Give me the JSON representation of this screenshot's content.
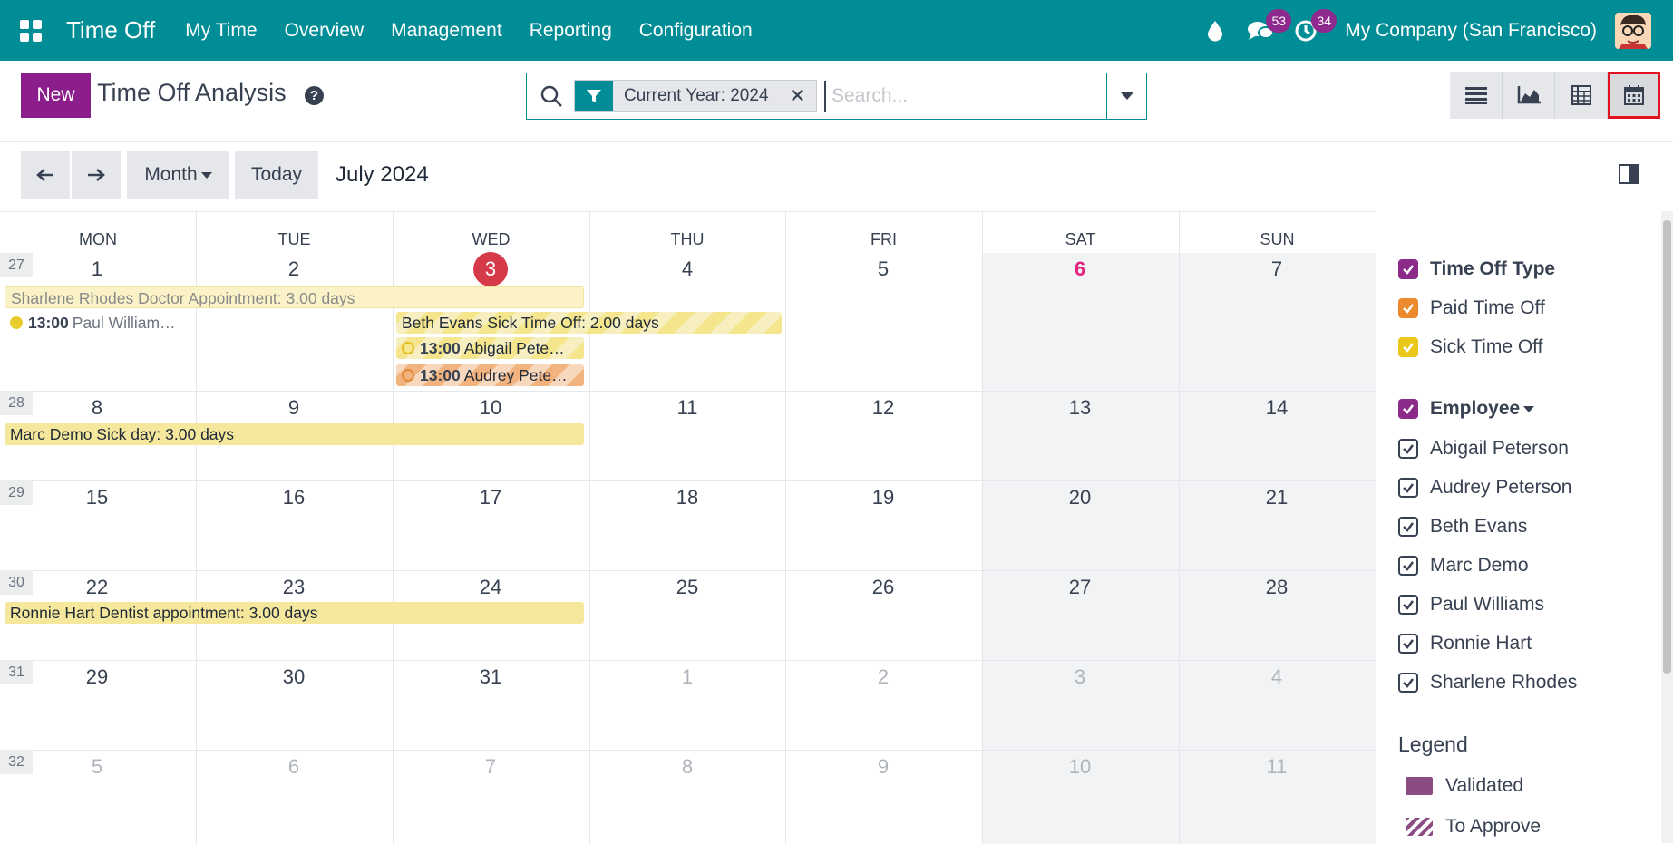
{
  "navbar": {
    "app_name": "Time Off",
    "menu": [
      "My Time",
      "Overview",
      "Management",
      "Reporting",
      "Configuration"
    ],
    "messages_count": "53",
    "activities_count": "34",
    "company": "My Company (San Francisco)"
  },
  "control": {
    "new_label": "New",
    "title": "Time Off Analysis",
    "facet_label": "Current Year: 2024",
    "search_placeholder": "Search..."
  },
  "toolbar": {
    "scale_label": "Month",
    "today_label": "Today",
    "period": "July 2024"
  },
  "calendar": {
    "weekdays": [
      "MON",
      "TUE",
      "WED",
      "THU",
      "FRI",
      "SAT",
      "SUN"
    ],
    "weeks": [
      {
        "num": "27",
        "days": [
          "1",
          "2",
          "3",
          "4",
          "5",
          "6",
          "7"
        ]
      },
      {
        "num": "28",
        "days": [
          "8",
          "9",
          "10",
          "11",
          "12",
          "13",
          "14"
        ]
      },
      {
        "num": "29",
        "days": [
          "15",
          "16",
          "17",
          "18",
          "19",
          "20",
          "21"
        ]
      },
      {
        "num": "30",
        "days": [
          "22",
          "23",
          "24",
          "25",
          "26",
          "27",
          "28"
        ]
      },
      {
        "num": "31",
        "days": [
          "29",
          "30",
          "31",
          "1",
          "2",
          "3",
          "4"
        ]
      },
      {
        "num": "32",
        "days": [
          "5",
          "6",
          "7",
          "8",
          "9",
          "10",
          "11"
        ]
      }
    ],
    "events": {
      "sharlene": "Sharlene Rhodes Doctor Appointment: 3.00 days",
      "paul_time": "13:00",
      "paul_name": "Paul William…",
      "beth": "Beth Evans Sick Time Off: 2.00 days",
      "abigail_time": "13:00",
      "abigail_name": "Abigail Pete…",
      "audrey_time": "13:00",
      "audrey_name": "Audrey Pete…",
      "marc": "Marc Demo Sick day: 3.00 days",
      "ronnie": "Ronnie Hart Dentist appointment: 3.00 days"
    },
    "colors": {
      "today": "#d63a48",
      "weekend_highlight": "#e2217c",
      "brand": "#018d96",
      "primary": "#8c1e8c"
    }
  },
  "sidepanel": {
    "type_header": "Time Off Type",
    "types": [
      "Paid Time Off",
      "Sick Time Off"
    ],
    "employee_header": "Employee",
    "employees": [
      "Abigail Peterson",
      "Audrey Peterson",
      "Beth Evans",
      "Marc Demo",
      "Paul Williams",
      "Ronnie Hart",
      "Sharlene Rhodes"
    ],
    "legend_title": "Legend",
    "legend": [
      "Validated",
      "To Approve"
    ]
  }
}
